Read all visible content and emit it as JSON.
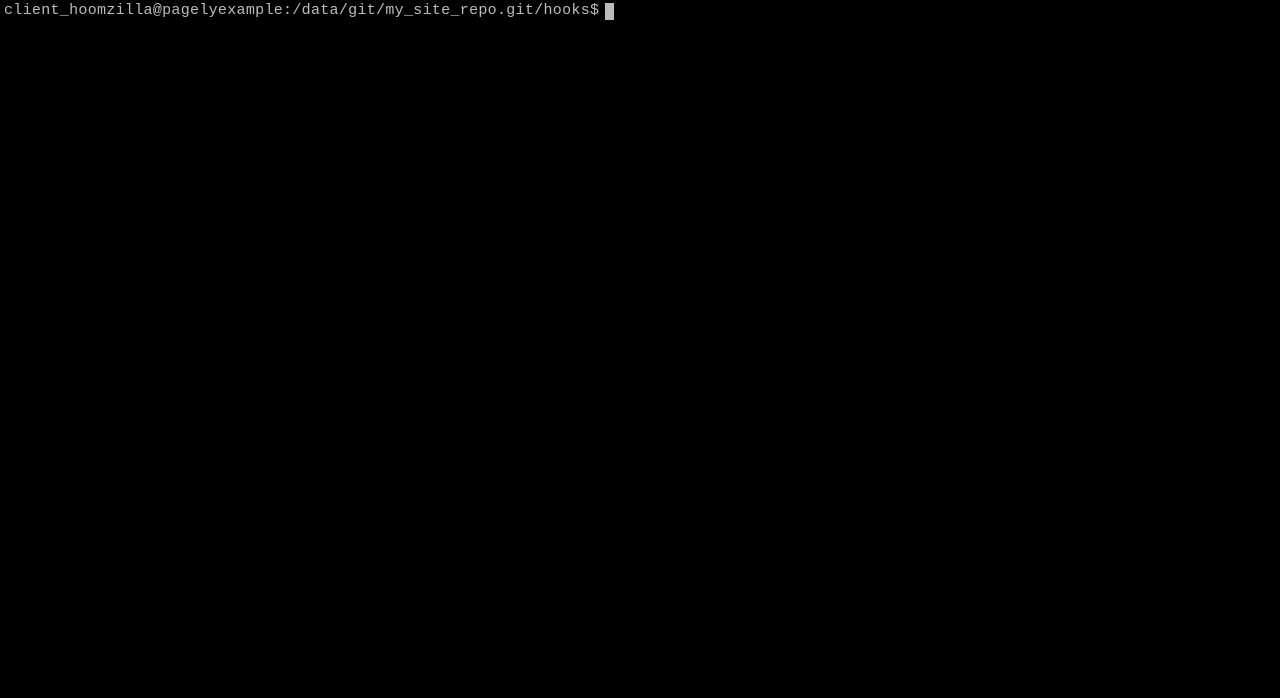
{
  "terminal": {
    "prompt": "client_hoomzilla@pagelyexample:/data/git/my_site_repo.git/hooks$"
  }
}
